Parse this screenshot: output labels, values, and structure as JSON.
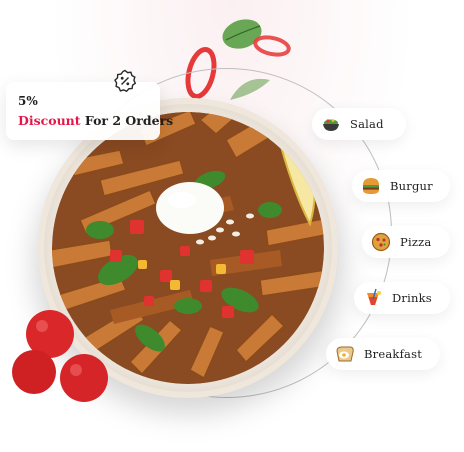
{
  "discount": {
    "percent": "5%",
    "accent": "Discount",
    "rest": " For 2 Orders",
    "accent_color": "#e5174a",
    "icon": "discount-badge-icon"
  },
  "menu": {
    "items": [
      {
        "label": "Salad",
        "icon": "salad-bowl-icon"
      },
      {
        "label": "Burgur",
        "icon": "burger-icon"
      },
      {
        "label": "Pizza",
        "icon": "pizza-icon"
      },
      {
        "label": "Drinks",
        "icon": "drink-icon"
      },
      {
        "label": "Breakfast",
        "icon": "breakfast-icon"
      }
    ]
  }
}
